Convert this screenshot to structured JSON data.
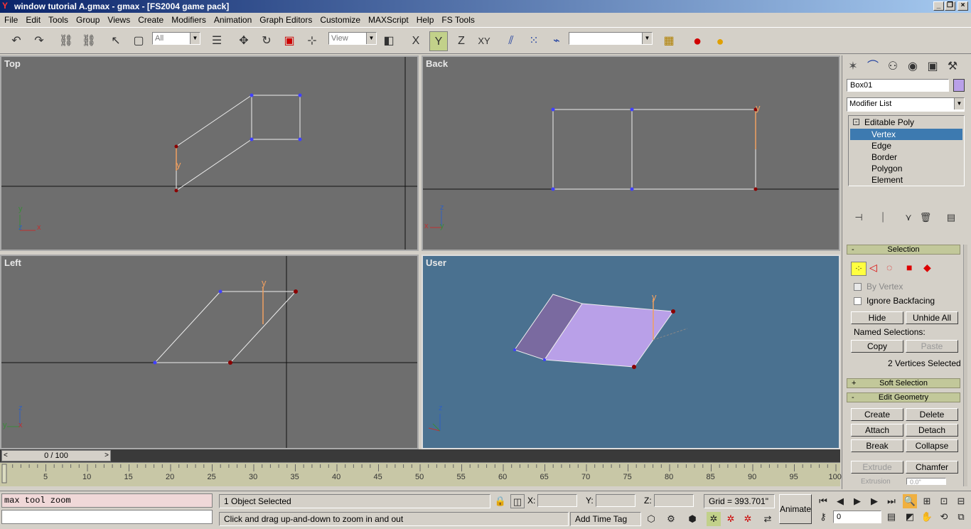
{
  "window": {
    "title": "window tutorial A.gmax - gmax - [FS2004 game pack]"
  },
  "menu": [
    "File",
    "Edit",
    "Tools",
    "Group",
    "Views",
    "Create",
    "Modifiers",
    "Animation",
    "Graph Editors",
    "Customize",
    "MAXScript",
    "Help",
    "FS Tools"
  ],
  "toolbar": {
    "selection_filter": "All",
    "ref_coord": "View",
    "constraint_x": "X",
    "constraint_y": "Y",
    "constraint_z": "Z",
    "constraint_xy": "XY"
  },
  "viewports": {
    "top": "Top",
    "back": "Back",
    "left": "Left",
    "user": "User"
  },
  "gizmo": {
    "y": "y",
    "x": "x",
    "z": "z"
  },
  "command_panel": {
    "object_name": "Box01",
    "object_color": "#b9a0e8",
    "modifier_list": "Modifier List",
    "stack": [
      "Editable Poly",
      "Vertex",
      "Edge",
      "Border",
      "Polygon",
      "Element"
    ],
    "selection_rollout": "Selection",
    "sign_minus": "-",
    "sign_plus": "+",
    "by_vertex": "By Vertex",
    "ignore_backfacing": "Ignore Backfacing",
    "hide": "Hide",
    "unhide_all": "Unhide All",
    "named_selections": "Named Selections:",
    "copy": "Copy",
    "paste": "Paste",
    "selected_count": "2 Vertices Selected",
    "soft_selection": "Soft Selection",
    "edit_geometry": "Edit Geometry",
    "create": "Create",
    "delete": "Delete",
    "attach": "Attach",
    "detach": "Detach",
    "break": "Break",
    "collapse": "Collapse",
    "extrude": "Extrude",
    "chamfer": "Chamfer",
    "extrusion": "Extrusion",
    "extrusion_value": "0.0\""
  },
  "timeline": {
    "frame": "0 / 100",
    "ticks": [
      "5",
      "10",
      "15",
      "20",
      "25",
      "30",
      "35",
      "40",
      "45",
      "50",
      "55",
      "60",
      "65",
      "70",
      "75",
      "80",
      "85",
      "90",
      "95",
      "100"
    ]
  },
  "status": {
    "script_line": "max tool zoom",
    "objects_selected": "1 Object Selected",
    "prompt": "Click and drag up-and-down to zoom in and out",
    "x_label": "X:",
    "y_label": "Y:",
    "z_label": "Z:",
    "grid": "Grid = 393.701\"",
    "add_time_tag": "Add Time Tag",
    "animate": "Animate",
    "frame_field": "0"
  },
  "colors": {
    "accent": "#c2d18a",
    "title_start": "#0a246a",
    "viewport_gray": "#6e6e6e",
    "viewport_user": "#4a7190",
    "selected_vertex": "#8b0000",
    "vertex": "#4040ff"
  }
}
